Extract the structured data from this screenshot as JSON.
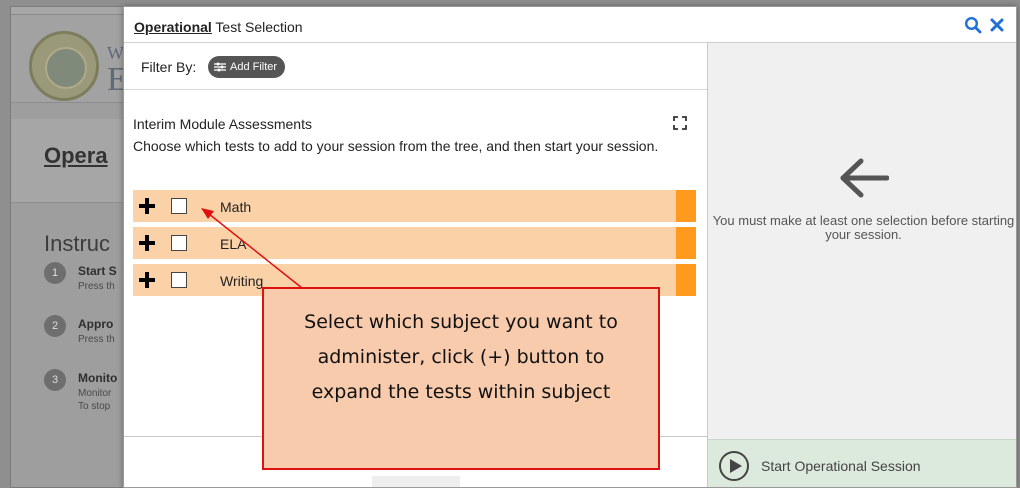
{
  "background": {
    "brand_small": "We",
    "brand_big": "E",
    "page_title": "Opera",
    "instructions_heading": "Instruc",
    "steps": [
      {
        "num": "1",
        "title": "Start S",
        "desc": "Press th"
      },
      {
        "num": "2",
        "title": "Appro",
        "desc": "Press th"
      },
      {
        "num": "3",
        "title": "Monito",
        "desc": "Monitor",
        "desc2": "To stop"
      }
    ]
  },
  "modal": {
    "title_underlined": "Operational",
    "title_rest": " Test Selection",
    "search_icon": "search-icon",
    "close_icon": "close-icon",
    "filter_label": "Filter By:",
    "add_filter_label": "Add Filter",
    "section_title": "Interim Module Assessments",
    "section_desc": "Choose which tests to add to your session from the tree, and then start your session.",
    "tree": [
      {
        "label": "Math"
      },
      {
        "label": "ELA"
      },
      {
        "label": "Writing"
      }
    ],
    "right_message": "You must make at least one selection before starting your session.",
    "start_button": "Start Operational Session"
  },
  "callout": {
    "text": "Select which subject you want to administer, click (+) button to expand the tests within subject"
  },
  "colors": {
    "row_bg": "#fbd2a8",
    "row_accent": "#ff9a1e",
    "callout_bg": "#f8cbad",
    "callout_border": "#e01010",
    "start_bg": "#dce9dd",
    "icon_blue": "#1f6fd6"
  }
}
